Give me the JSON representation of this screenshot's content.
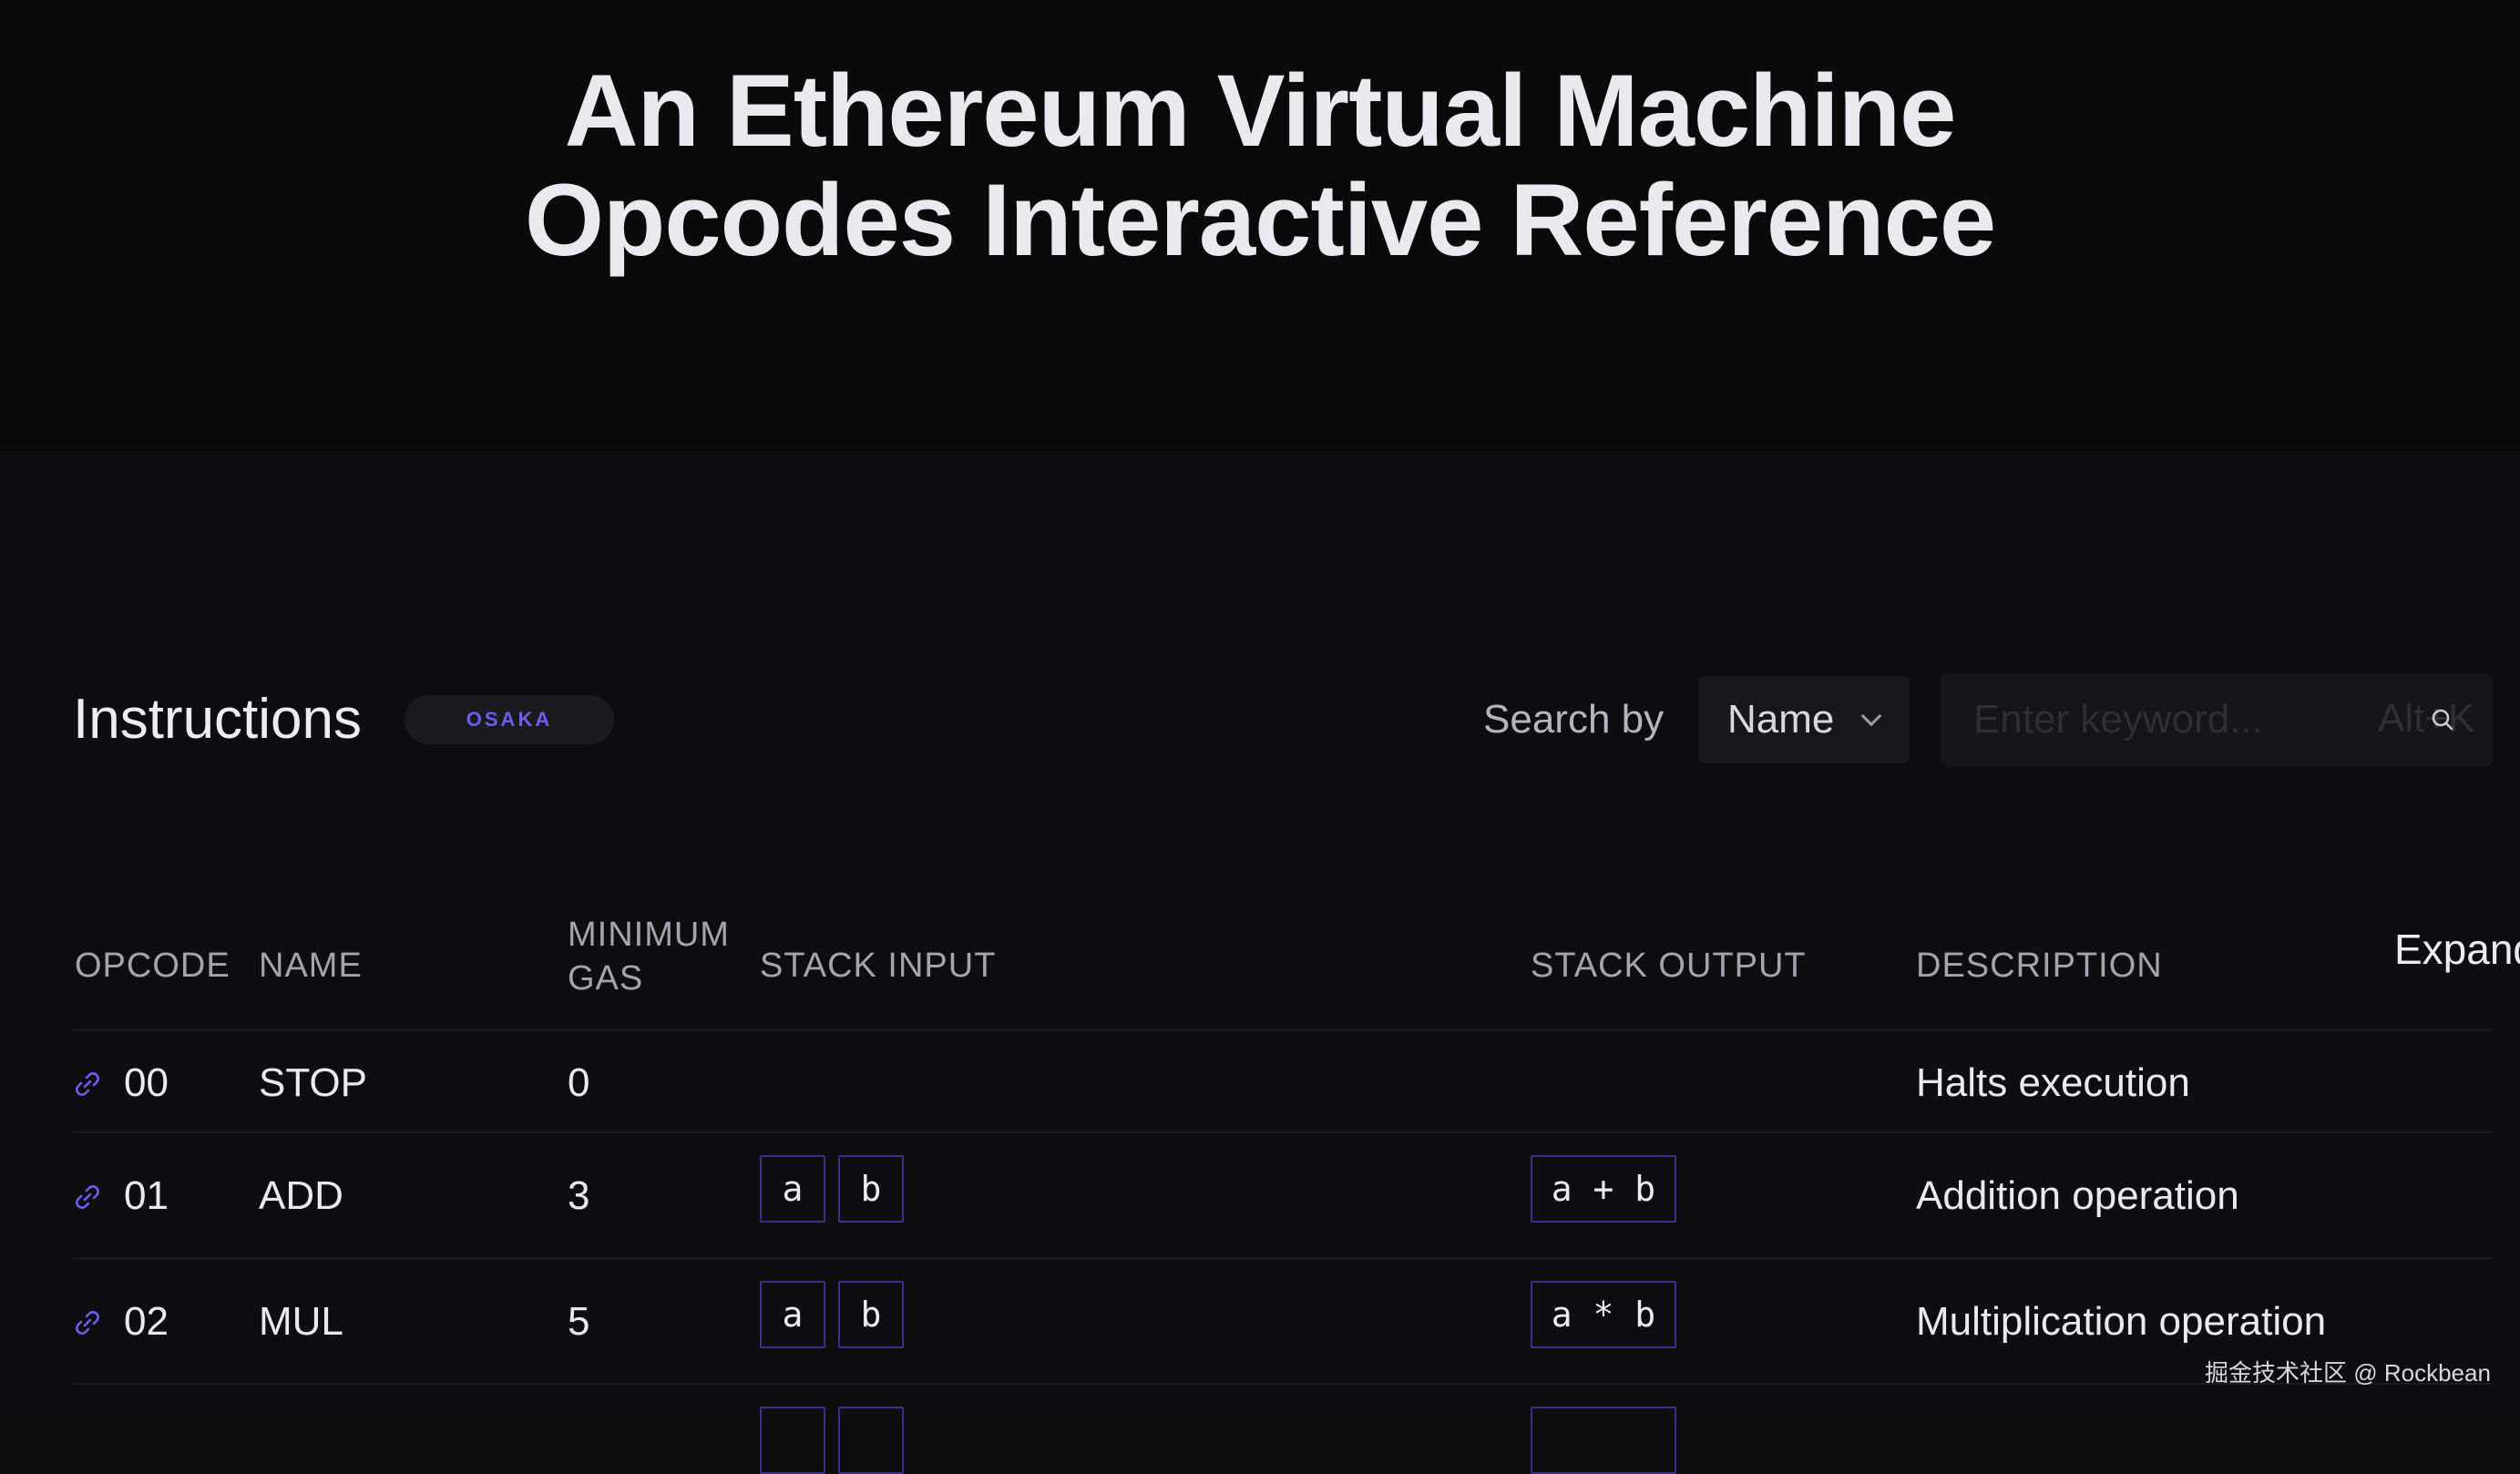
{
  "hero": {
    "title_line1": "An Ethereum Virtual Machine",
    "title_line2": "Opcodes Interactive Reference"
  },
  "toolbar": {
    "section_title": "Instructions",
    "fork_badge": "OSAKA",
    "search_by_label": "Search by",
    "search_by_selected": "Name",
    "search_placeholder": "Enter keyword...",
    "shortcut_hint": "Alt+K"
  },
  "table": {
    "headers": {
      "opcode": "OPCODE",
      "name": "NAME",
      "min_gas_line1": "MINIMUM",
      "min_gas_line2": "GAS",
      "stack_input": "STACK INPUT",
      "stack_output": "STACK OUTPUT",
      "description": "DESCRIPTION"
    },
    "expand_label": "Expand",
    "rows": [
      {
        "opcode": "00",
        "name": "STOP",
        "gas": "0",
        "inputs": [],
        "outputs": [],
        "description": "Halts execution"
      },
      {
        "opcode": "01",
        "name": "ADD",
        "gas": "3",
        "inputs": [
          "a",
          "b"
        ],
        "outputs": [
          "a + b"
        ],
        "description": "Addition operation"
      },
      {
        "opcode": "02",
        "name": "MUL",
        "gas": "5",
        "inputs": [
          "a",
          "b"
        ],
        "outputs": [
          "a * b"
        ],
        "description": "Multiplication operation"
      }
    ]
  },
  "watermark": "掘金技术社区 @ Rockbean",
  "colors": {
    "accent": "#6f5cf0",
    "chip_border": "#3a2f8a",
    "background": "#0e0e10",
    "hero_background": "#0a0a0b"
  },
  "icons": {
    "row_link": "link-icon",
    "search": "search-icon",
    "select_chevron": "chevron-down-icon"
  }
}
